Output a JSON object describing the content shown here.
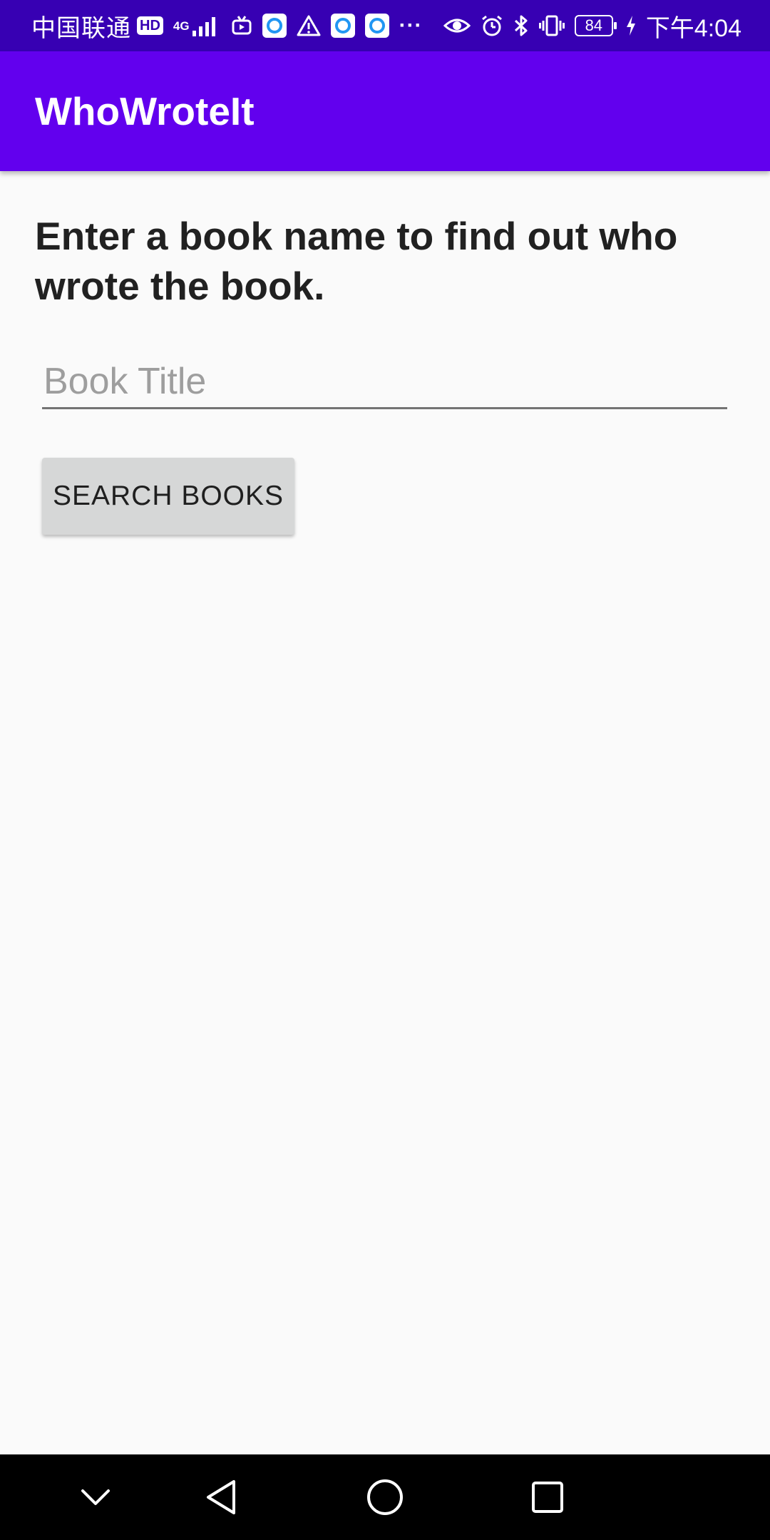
{
  "status_bar": {
    "carrier": "中国联通",
    "hd_label": "HD",
    "network_label": "4G",
    "battery_level": "84",
    "time": "下午4:04",
    "more_label": "···"
  },
  "app_bar": {
    "title": "WhoWroteIt",
    "color": "#6200ee",
    "status_color": "#3700b3"
  },
  "main": {
    "instructions": "Enter a book name to find out who wrote the book.",
    "book_input": {
      "placeholder": "Book Title",
      "value": ""
    },
    "search_button_label": "SEARCH BOOKS"
  },
  "nav_bar": {
    "icons": [
      "chevron-down-icon",
      "back-icon",
      "home-icon",
      "recents-icon"
    ]
  }
}
